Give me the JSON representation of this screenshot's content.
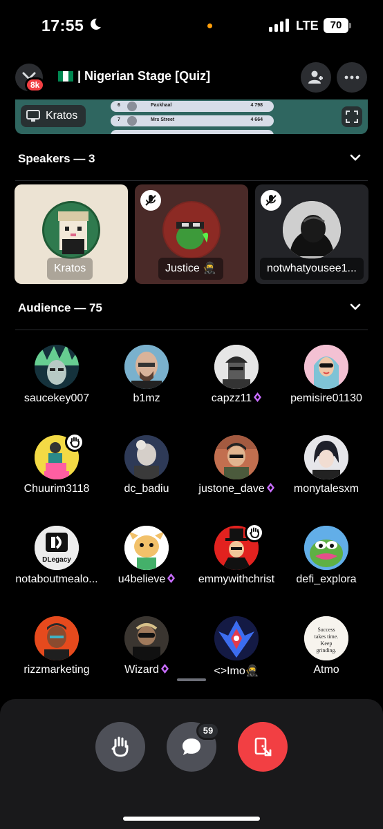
{
  "status": {
    "time": "17:55",
    "network": "LTE",
    "battery": "70"
  },
  "header": {
    "notif_badge": "8k",
    "title": "| Nigerian Stage [Quiz]",
    "flag_colors": [
      "#008751",
      "#ffffff",
      "#008751"
    ]
  },
  "share": {
    "streamer": "Kratos",
    "rows": [
      {
        "rank": "6",
        "name": "Paxkhaal",
        "score": "4 798"
      },
      {
        "rank": "7",
        "name": "Mrs Street",
        "score": "4 664"
      }
    ]
  },
  "speakers": {
    "header": "Speakers — 3",
    "items": [
      {
        "name": "Kratos"
      },
      {
        "name": "Justice 🥷"
      },
      {
        "name": "notwhatyousee1..."
      }
    ]
  },
  "audience": {
    "header": "Audience — 75",
    "members": [
      {
        "name": "saucekey007"
      },
      {
        "name": "b1mz"
      },
      {
        "name": "capzz11"
      },
      {
        "name": "pemisire01130"
      },
      {
        "name": "Chuurim3118"
      },
      {
        "name": "dc_badiu"
      },
      {
        "name": "justone_dave"
      },
      {
        "name": "monytalesxm"
      },
      {
        "name": "notaboutmealo..."
      },
      {
        "name": "u4believe"
      },
      {
        "name": "emmywithchrist"
      },
      {
        "name": "defi_explora"
      },
      {
        "name": "rizzmarketing"
      },
      {
        "name": "Wizard"
      },
      {
        "name": "<>Imo🥷"
      },
      {
        "name": "Atmo"
      }
    ],
    "avatar_texts": {
      "dlegacy": "DLegacy",
      "atmo_quote": "Success takes time. Keep grinding."
    }
  },
  "controls": {
    "chat_count": "59"
  },
  "colors": {
    "accent_red": "#f23f43",
    "nitro_purple": "#c86dff",
    "panel": "#19191b"
  }
}
